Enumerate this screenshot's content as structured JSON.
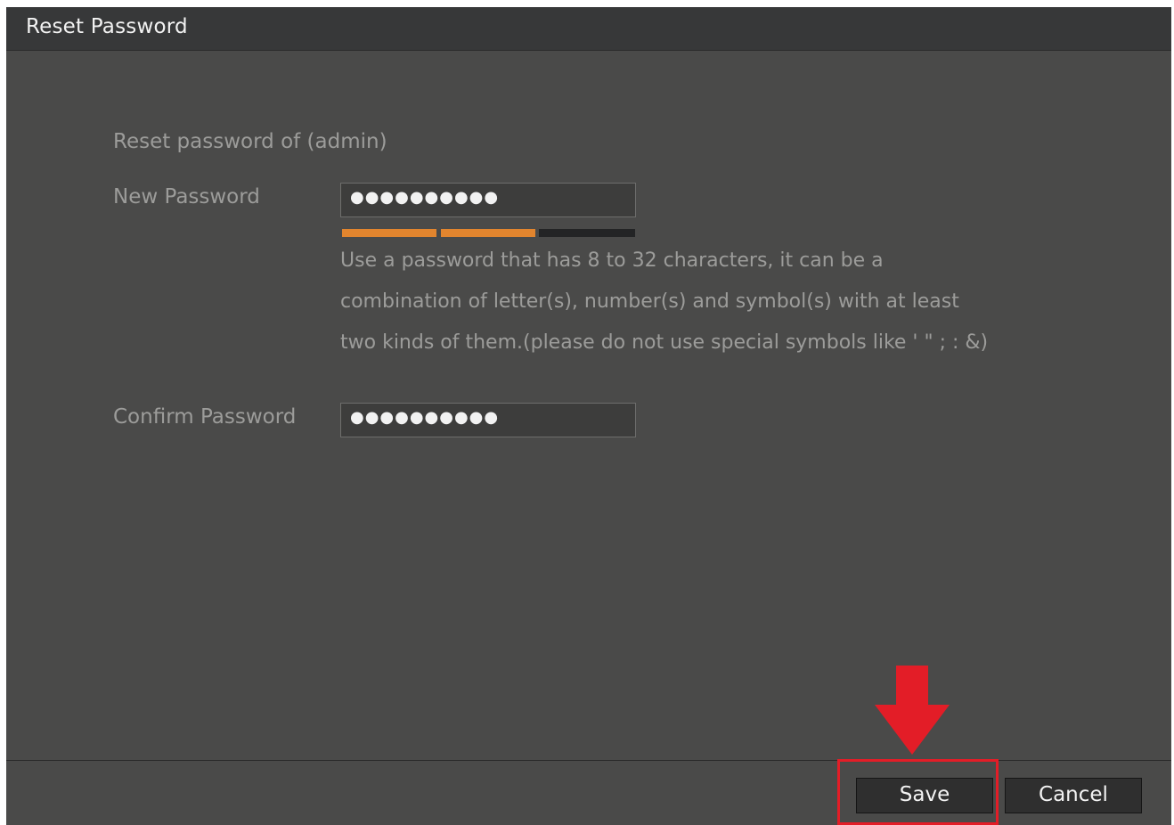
{
  "dialog": {
    "title": "Reset Password"
  },
  "form": {
    "reset_for": "Reset password of (admin)",
    "new_password_label": "New Password",
    "new_password_value": "●●●●●●●●●●",
    "password_strength_level": 2,
    "password_strength_total": 3,
    "hint_lines": [
      "Use a password that has 8 to 32 characters, it can be a",
      "combination of letter(s), number(s) and symbol(s) with at least",
      "two kinds of them.(please do not use special symbols like ' \" ; : &)"
    ],
    "confirm_password_label": "Confirm Password",
    "confirm_password_value": "●●●●●●●●●●"
  },
  "footer": {
    "save_label": "Save",
    "cancel_label": "Cancel"
  },
  "colors": {
    "strength_active": "#e2852e",
    "strength_inactive": "#232425",
    "highlight": "#e31d27"
  }
}
